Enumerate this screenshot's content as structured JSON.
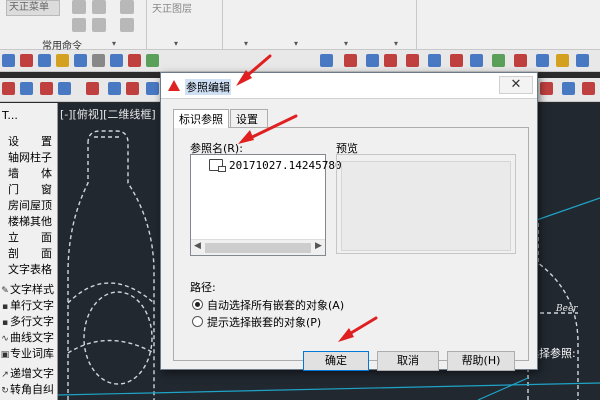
{
  "ribbon": {
    "menu_label": "天正菜单",
    "group_label": "常用命令",
    "layer_label": "天正图层"
  },
  "left_panel": {
    "title": "T...",
    "items": [
      "设　　置",
      "轴网柱子",
      "墙　　体",
      "门　　窗",
      "房间屋顶",
      "楼梯其他",
      "立　　面",
      "剖　　面",
      "文字表格"
    ],
    "sub_items": [
      "文字样式",
      "单行文字",
      "多行文字",
      "曲线文字",
      "专业词库",
      "递增文字",
      "转角自纠"
    ]
  },
  "canvas": {
    "viewport_label": "[-][俯视][二维线框]",
    "side_label": "选择参照:"
  },
  "dialog": {
    "title": "参照编辑",
    "close_symbol": "✕",
    "tabs": [
      "标识参照",
      "设置"
    ],
    "ref_name_label": "参照名(R):",
    "ref_item": "20171027.14245780",
    "preview_label": "预览",
    "path_label": "路径:",
    "radio_options": [
      {
        "label": "自动选择所有嵌套的对象(A)",
        "selected": true
      },
      {
        "label": "提示选择嵌套的对象(P)",
        "selected": false
      }
    ],
    "buttons": {
      "ok": "确定",
      "cancel": "取消",
      "help": "帮助(H)"
    }
  },
  "colors": {
    "canvas_bg": "#212830",
    "cad_lines": "#cfd6dc",
    "cyan_lines": "#1fa3c7",
    "annotation_arrow": "#e02020"
  }
}
